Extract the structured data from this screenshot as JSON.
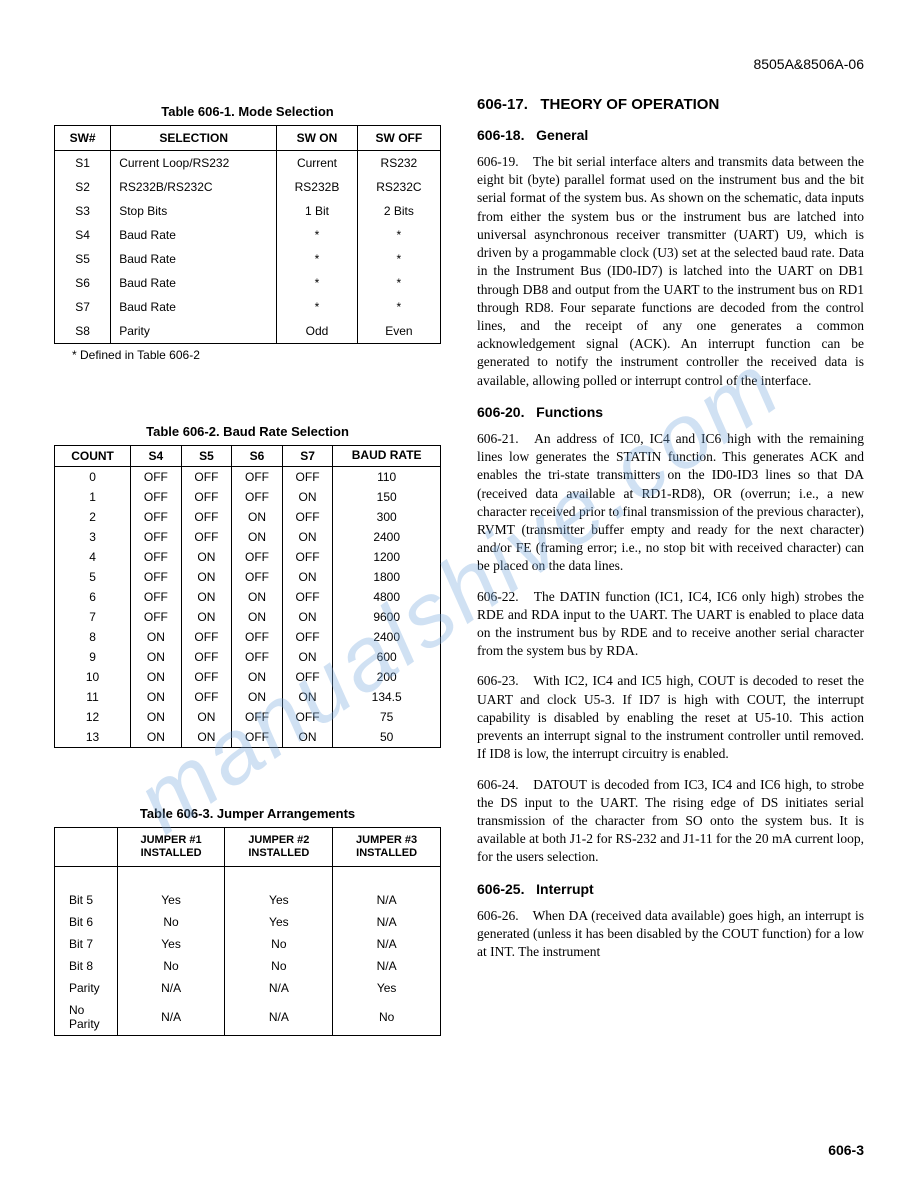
{
  "doc_id": "8505A&8506A-06",
  "page_number": "606-3",
  "watermark": "manualshive.com",
  "table1": {
    "caption": "Table 606-1. Mode Selection",
    "headers": [
      "SW#",
      "SELECTION",
      "SW ON",
      "SW OFF"
    ],
    "rows": [
      [
        "S1",
        "Current Loop/RS232",
        "Current",
        "RS232"
      ],
      [
        "S2",
        "RS232B/RS232C",
        "RS232B",
        "RS232C"
      ],
      [
        "S3",
        "Stop Bits",
        "1 Bit",
        "2 Bits"
      ],
      [
        "S4",
        "Baud Rate",
        "*",
        "*"
      ],
      [
        "S5",
        "Baud Rate",
        "*",
        "*"
      ],
      [
        "S6",
        "Baud Rate",
        "*",
        "*"
      ],
      [
        "S7",
        "Baud Rate",
        "*",
        "*"
      ],
      [
        "S8",
        "Parity",
        "Odd",
        "Even"
      ]
    ],
    "footnote": "* Defined in Table 606-2"
  },
  "table2": {
    "caption": "Table 606-2. Baud Rate Selection",
    "headers": [
      "COUNT",
      "S4",
      "S5",
      "S6",
      "S7",
      "BAUD RATE"
    ],
    "rows": [
      [
        "0",
        "OFF",
        "OFF",
        "OFF",
        "OFF",
        "110"
      ],
      [
        "1",
        "OFF",
        "OFF",
        "OFF",
        "ON",
        "150"
      ],
      [
        "2",
        "OFF",
        "OFF",
        "ON",
        "OFF",
        "300"
      ],
      [
        "3",
        "OFF",
        "OFF",
        "ON",
        "ON",
        "2400"
      ],
      [
        "4",
        "OFF",
        "ON",
        "OFF",
        "OFF",
        "1200"
      ],
      [
        "5",
        "OFF",
        "ON",
        "OFF",
        "ON",
        "1800"
      ],
      [
        "6",
        "OFF",
        "ON",
        "ON",
        "OFF",
        "4800"
      ],
      [
        "7",
        "OFF",
        "ON",
        "ON",
        "ON",
        "9600"
      ],
      [
        "8",
        "ON",
        "OFF",
        "OFF",
        "OFF",
        "2400"
      ],
      [
        "9",
        "ON",
        "OFF",
        "OFF",
        "ON",
        "600"
      ],
      [
        "10",
        "ON",
        "OFF",
        "ON",
        "OFF",
        "200"
      ],
      [
        "11",
        "ON",
        "OFF",
        "ON",
        "ON",
        "134.5"
      ],
      [
        "12",
        "ON",
        "ON",
        "OFF",
        "OFF",
        "75"
      ],
      [
        "13",
        "ON",
        "ON",
        "OFF",
        "ON",
        "50"
      ]
    ]
  },
  "table3": {
    "caption": "Table 606-3. Jumper Arrangements",
    "headers": [
      "",
      "JUMPER #1 INSTALLED",
      "JUMPER #2 INSTALLED",
      "JUMPER #3 INSTALLED"
    ],
    "rows": [
      [
        "Bit 5",
        "Yes",
        "Yes",
        "N/A"
      ],
      [
        "Bit 6",
        "No",
        "Yes",
        "N/A"
      ],
      [
        "Bit 7",
        "Yes",
        "No",
        "N/A"
      ],
      [
        "Bit 8",
        "No",
        "No",
        "N/A"
      ],
      [
        "Parity",
        "N/A",
        "N/A",
        "Yes"
      ],
      [
        "No Parity",
        "N/A",
        "N/A",
        "No"
      ]
    ]
  },
  "sections": {
    "h17": {
      "num": "606-17.",
      "title": "THEORY OF OPERATION"
    },
    "h18": {
      "num": "606-18.",
      "title": "General"
    },
    "p19": {
      "num": "606-19.",
      "text": "The bit serial interface alters and transmits data between the eight bit (byte) parallel format used on the instrument bus and the bit serial format of the system bus. As shown on the schematic, data inputs from either the system bus or the instrument bus are latched into universal asynchronous receiver transmitter (UART) U9, which is driven by a progammable clock (U3) set at the selected baud rate. Data in the Instrument Bus (ID0-ID7) is latched into the UART on DB1 through DB8 and output from the UART to the instrument bus on RD1 through RD8. Four separate functions are decoded from the control lines, and the receipt of any one generates a common acknowledgement signal (ACK). An interrupt function can be generated to notify the instrument controller the received data is available, allowing polled or interrupt control of the interface."
    },
    "h20": {
      "num": "606-20.",
      "title": "Functions"
    },
    "p21": {
      "num": "606-21.",
      "text": "An address of IC0, IC4 and IC6 high with the remaining lines low generates the STATIN function. This generates ACK and enables the tri-state transmitters on the ID0-ID3 lines so that DA (received data available at RD1-RD8), OR (overrun; i.e., a new character received prior to final transmission of the previous character), RVMT (transmitter buffer empty and ready for the next character) and/or FE (framing error; i.e., no stop bit with received character) can be placed on the data lines."
    },
    "p22": {
      "num": "606-22.",
      "text": "The DATIN function (IC1, IC4, IC6 only high) strobes the RDE and RDA input to the UART. The UART is enabled to place data on the instrument bus by RDE and to receive another serial character from the system bus by RDA."
    },
    "p23": {
      "num": "606-23.",
      "text": "With IC2, IC4 and IC5 high, COUT is decoded to reset the UART and clock U5-3. If ID7 is high with COUT, the interrupt capability is disabled by enabling the reset at U5-10. This action prevents an interrupt signal to the instrument controller until removed. If ID8 is low, the interrupt circuitry is enabled."
    },
    "p24": {
      "num": "606-24.",
      "text": "DATOUT is decoded from IC3, IC4 and IC6 high, to strobe the DS input to the UART. The rising edge of DS initiates serial transmission of the character from SO onto the system bus. It is available at both J1-2 for RS-232 and J1-11 for the 20 mA current loop, for the users selection."
    },
    "h25": {
      "num": "606-25.",
      "title": "Interrupt"
    },
    "p26": {
      "num": "606-26.",
      "text": "When DA (received data available) goes high, an interrupt is generated (unless it has been disabled by the COUT function) for a low at INT. The instrument"
    }
  }
}
